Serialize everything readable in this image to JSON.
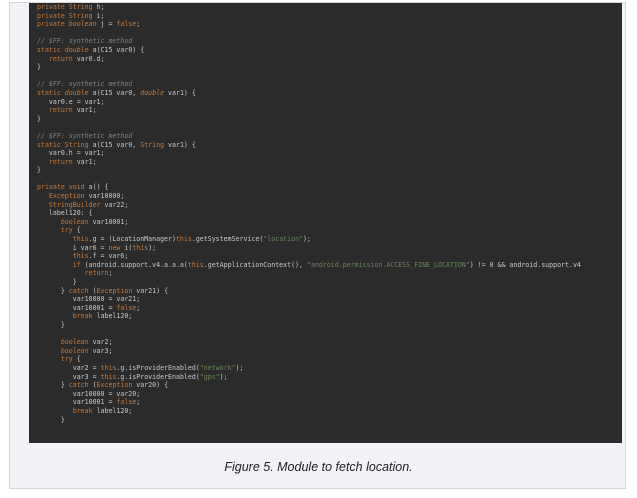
{
  "caption": "Figure 5. Module to fetch location.",
  "code_lines": [
    [
      {
        "t": "private ",
        "c": "kw"
      },
      {
        "t": "String",
        "c": "ty"
      },
      {
        "t": " h;",
        "c": "fn"
      }
    ],
    [
      {
        "t": "private ",
        "c": "kw"
      },
      {
        "t": "String",
        "c": "ty"
      },
      {
        "t": " i;",
        "c": "fn"
      }
    ],
    [
      {
        "t": "private ",
        "c": "kw"
      },
      {
        "t": "boolean",
        "c": "it"
      },
      {
        "t": " j = ",
        "c": "fn"
      },
      {
        "t": "false",
        "c": "kw"
      },
      {
        "t": ";",
        "c": "fn"
      }
    ],
    [],
    [
      {
        "t": "// $FF: synthetic method",
        "c": "cm"
      }
    ],
    [
      {
        "t": "static ",
        "c": "kw"
      },
      {
        "t": "double",
        "c": "it"
      },
      {
        "t": " a(C15 var0) {",
        "c": "fn"
      }
    ],
    [
      {
        "t": "   return ",
        "c": "kw"
      },
      {
        "t": "var0.d;",
        "c": "fn"
      }
    ],
    [
      {
        "t": "}",
        "c": "fn"
      }
    ],
    [],
    [
      {
        "t": "// $FF: synthetic method",
        "c": "cm"
      }
    ],
    [
      {
        "t": "static ",
        "c": "kw"
      },
      {
        "t": "double",
        "c": "it"
      },
      {
        "t": " a(C15 var0, ",
        "c": "fn"
      },
      {
        "t": "double",
        "c": "it"
      },
      {
        "t": " var1) {",
        "c": "fn"
      }
    ],
    [
      {
        "t": "   var0.e = var1;",
        "c": "fn"
      }
    ],
    [
      {
        "t": "   return ",
        "c": "kw"
      },
      {
        "t": "var1;",
        "c": "fn"
      }
    ],
    [
      {
        "t": "}",
        "c": "fn"
      }
    ],
    [],
    [
      {
        "t": "// $FF: synthetic method",
        "c": "cm"
      }
    ],
    [
      {
        "t": "static ",
        "c": "kw"
      },
      {
        "t": "String",
        "c": "ty"
      },
      {
        "t": " a(C15 var0, ",
        "c": "fn"
      },
      {
        "t": "String",
        "c": "ty"
      },
      {
        "t": " var1) {",
        "c": "fn"
      }
    ],
    [
      {
        "t": "   var0.h = var1;",
        "c": "fn"
      }
    ],
    [
      {
        "t": "   return ",
        "c": "kw"
      },
      {
        "t": "var1;",
        "c": "fn"
      }
    ],
    [
      {
        "t": "}",
        "c": "fn"
      }
    ],
    [],
    [
      {
        "t": "private ",
        "c": "kw"
      },
      {
        "t": "void",
        "c": "kw"
      },
      {
        "t": " a() {",
        "c": "fn"
      }
    ],
    [
      {
        "t": "   Exception",
        "c": "ty"
      },
      {
        "t": " var10000;",
        "c": "fn"
      }
    ],
    [
      {
        "t": "   StringBuilder",
        "c": "ty"
      },
      {
        "t": " var22;",
        "c": "fn"
      }
    ],
    [
      {
        "t": "   label120: {",
        "c": "fn"
      }
    ],
    [
      {
        "t": "      boolean",
        "c": "it"
      },
      {
        "t": " var10001;",
        "c": "fn"
      }
    ],
    [
      {
        "t": "      try ",
        "c": "kw"
      },
      {
        "t": "{",
        "c": "fn"
      }
    ],
    [
      {
        "t": "         this",
        "c": "kw"
      },
      {
        "t": ".g = (LocationManager)",
        "c": "fn"
      },
      {
        "t": "this",
        "c": "kw"
      },
      {
        "t": ".getSystemService(",
        "c": "fn"
      },
      {
        "t": "\"location\"",
        "c": "st"
      },
      {
        "t": ");",
        "c": "fn"
      }
    ],
    [
      {
        "t": "         i var6 = ",
        "c": "fn"
      },
      {
        "t": "new ",
        "c": "kw"
      },
      {
        "t": "i(",
        "c": "fn"
      },
      {
        "t": "this",
        "c": "kw"
      },
      {
        "t": ");",
        "c": "fn"
      }
    ],
    [
      {
        "t": "         this",
        "c": "kw"
      },
      {
        "t": ".f = var6;",
        "c": "fn"
      }
    ],
    [
      {
        "t": "         if ",
        "c": "kw"
      },
      {
        "t": "(android.support.v4.a.a.a(",
        "c": "fn"
      },
      {
        "t": "this",
        "c": "kw"
      },
      {
        "t": ".getApplicationContext(), ",
        "c": "fn"
      },
      {
        "t": "\"android.permission.ACCESS_FINE_LOCATION\"",
        "c": "st"
      },
      {
        "t": ") != 0 && android.support.v4",
        "c": "fn"
      }
    ],
    [
      {
        "t": "            return",
        "c": "kw"
      },
      {
        "t": ";",
        "c": "fn"
      }
    ],
    [
      {
        "t": "         }",
        "c": "fn"
      }
    ],
    [
      {
        "t": "      } ",
        "c": "fn"
      },
      {
        "t": "catch ",
        "c": "kw"
      },
      {
        "t": "(",
        "c": "fn"
      },
      {
        "t": "Exception",
        "c": "ty"
      },
      {
        "t": " var21) {",
        "c": "fn"
      }
    ],
    [
      {
        "t": "         var10000 = var21;",
        "c": "fn"
      }
    ],
    [
      {
        "t": "         var10001 = ",
        "c": "fn"
      },
      {
        "t": "false",
        "c": "kw"
      },
      {
        "t": ";",
        "c": "fn"
      }
    ],
    [
      {
        "t": "         break ",
        "c": "kw"
      },
      {
        "t": "label120;",
        "c": "fn"
      }
    ],
    [
      {
        "t": "      }",
        "c": "fn"
      }
    ],
    [],
    [
      {
        "t": "      boolean",
        "c": "it"
      },
      {
        "t": " var2;",
        "c": "fn"
      }
    ],
    [
      {
        "t": "      boolean",
        "c": "it"
      },
      {
        "t": " var3;",
        "c": "fn"
      }
    ],
    [
      {
        "t": "      try ",
        "c": "kw"
      },
      {
        "t": "{",
        "c": "fn"
      }
    ],
    [
      {
        "t": "         var2 = ",
        "c": "fn"
      },
      {
        "t": "this",
        "c": "kw"
      },
      {
        "t": ".g.isProviderEnabled(",
        "c": "fn"
      },
      {
        "t": "\"network\"",
        "c": "st"
      },
      {
        "t": ");",
        "c": "fn"
      }
    ],
    [
      {
        "t": "         var3 = ",
        "c": "fn"
      },
      {
        "t": "this",
        "c": "kw"
      },
      {
        "t": ".g.isProviderEnabled(",
        "c": "fn"
      },
      {
        "t": "\"gps\"",
        "c": "st"
      },
      {
        "t": ");",
        "c": "fn"
      }
    ],
    [
      {
        "t": "      } ",
        "c": "fn"
      },
      {
        "t": "catch ",
        "c": "kw"
      },
      {
        "t": "(",
        "c": "fn"
      },
      {
        "t": "Exception",
        "c": "ty"
      },
      {
        "t": " var20) {",
        "c": "fn"
      }
    ],
    [
      {
        "t": "         var10000 = var20;",
        "c": "fn"
      }
    ],
    [
      {
        "t": "         var10001 = ",
        "c": "fn"
      },
      {
        "t": "false",
        "c": "kw"
      },
      {
        "t": ";",
        "c": "fn"
      }
    ],
    [
      {
        "t": "         break ",
        "c": "kw"
      },
      {
        "t": "label120;",
        "c": "fn"
      }
    ],
    [
      {
        "t": "      }",
        "c": "fn"
      }
    ]
  ]
}
